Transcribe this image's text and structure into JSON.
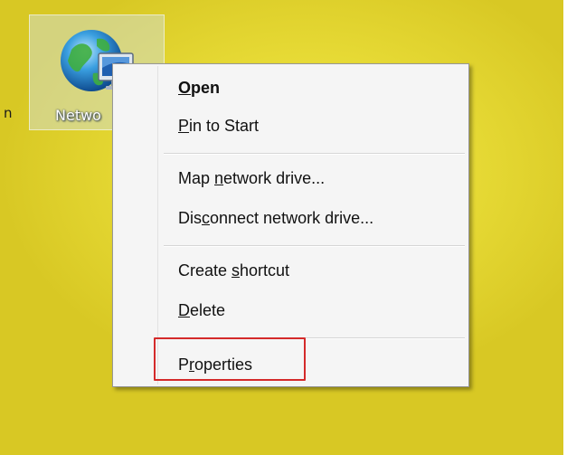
{
  "desktop": {
    "left_label": "n",
    "icon": {
      "name": "network-icon",
      "label": "Netwo"
    }
  },
  "menu": {
    "items": [
      {
        "pre": "",
        "key": "O",
        "post": "pen"
      },
      {
        "pre": "",
        "key": "P",
        "post": "in to Start"
      },
      {
        "pre": "Map ",
        "key": "n",
        "post": "etwork drive..."
      },
      {
        "pre": "Dis",
        "key": "c",
        "post": "onnect network drive..."
      },
      {
        "pre": "Create ",
        "key": "s",
        "post": "hortcut"
      },
      {
        "pre": "",
        "key": "D",
        "post": "elete"
      },
      {
        "pre": "P",
        "key": "r",
        "post": "operties"
      }
    ]
  },
  "colors": {
    "highlight_box": "#d42a2a",
    "desktop_yellow": "#e9dd38"
  }
}
